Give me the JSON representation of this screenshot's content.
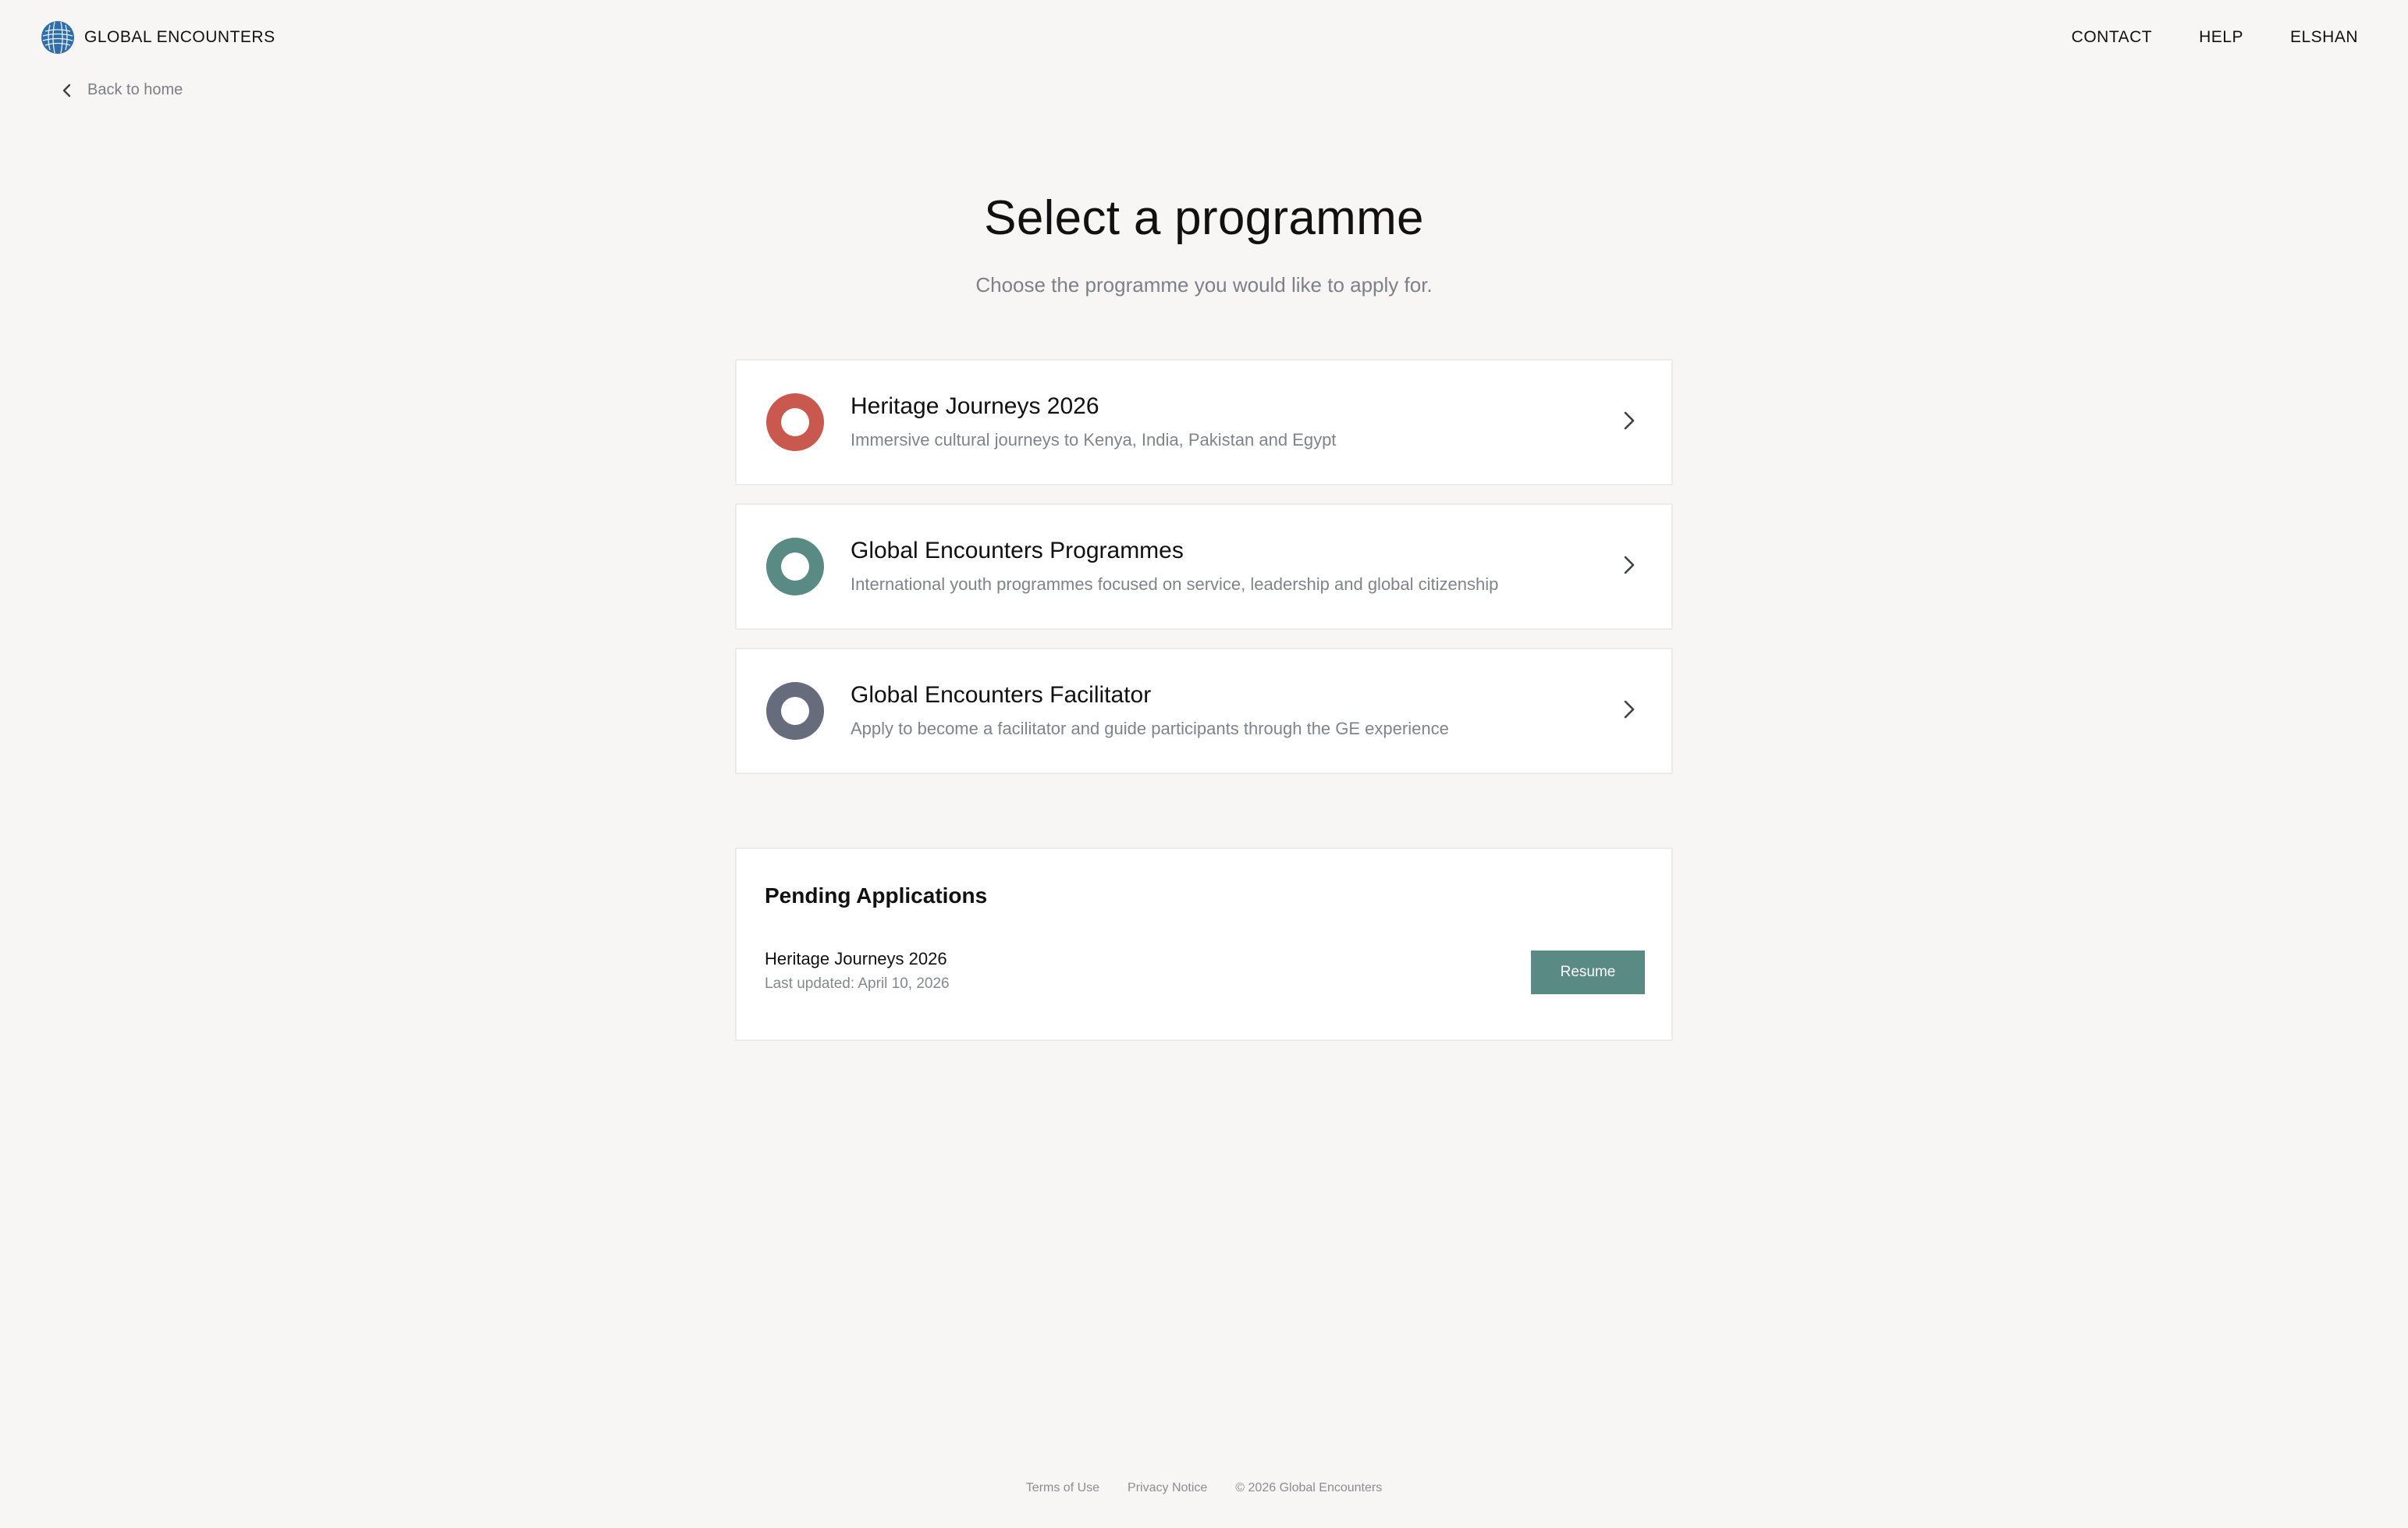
{
  "header": {
    "brand": "GLOBAL ENCOUNTERS",
    "nav": [
      "CONTACT",
      "HELP",
      "ELSHAN"
    ]
  },
  "back_link": "Back to home",
  "page": {
    "title": "Select a programme",
    "subtitle": "Choose the programme you would like to apply for."
  },
  "programmes": [
    {
      "name": "Heritage Journeys 2026",
      "description": "Immersive cultural journeys to Kenya, India, Pakistan and Egypt",
      "color": "#c9584f"
    },
    {
      "name": "Global Encounters Programmes",
      "description": "International youth programmes focused on service, leadership and global citizenship",
      "color": "#5a8a84"
    },
    {
      "name": "Global Encounters Facilitator",
      "description": "Apply to become a facilitator and guide participants through the GE experience",
      "color": "#666c7b"
    }
  ],
  "pending": {
    "title": "Pending Applications",
    "items": [
      {
        "name": "Heritage Journeys 2026",
        "updated": "Last updated: April 10, 2026",
        "action": "Resume"
      }
    ]
  },
  "footer": {
    "terms": "Terms of Use",
    "privacy": "Privacy Notice",
    "copyright": "© 2026 Global Encounters"
  },
  "colors": {
    "background": "#f7f6f4",
    "accent": "#5a8a84",
    "logo": "#2f6ea8"
  }
}
